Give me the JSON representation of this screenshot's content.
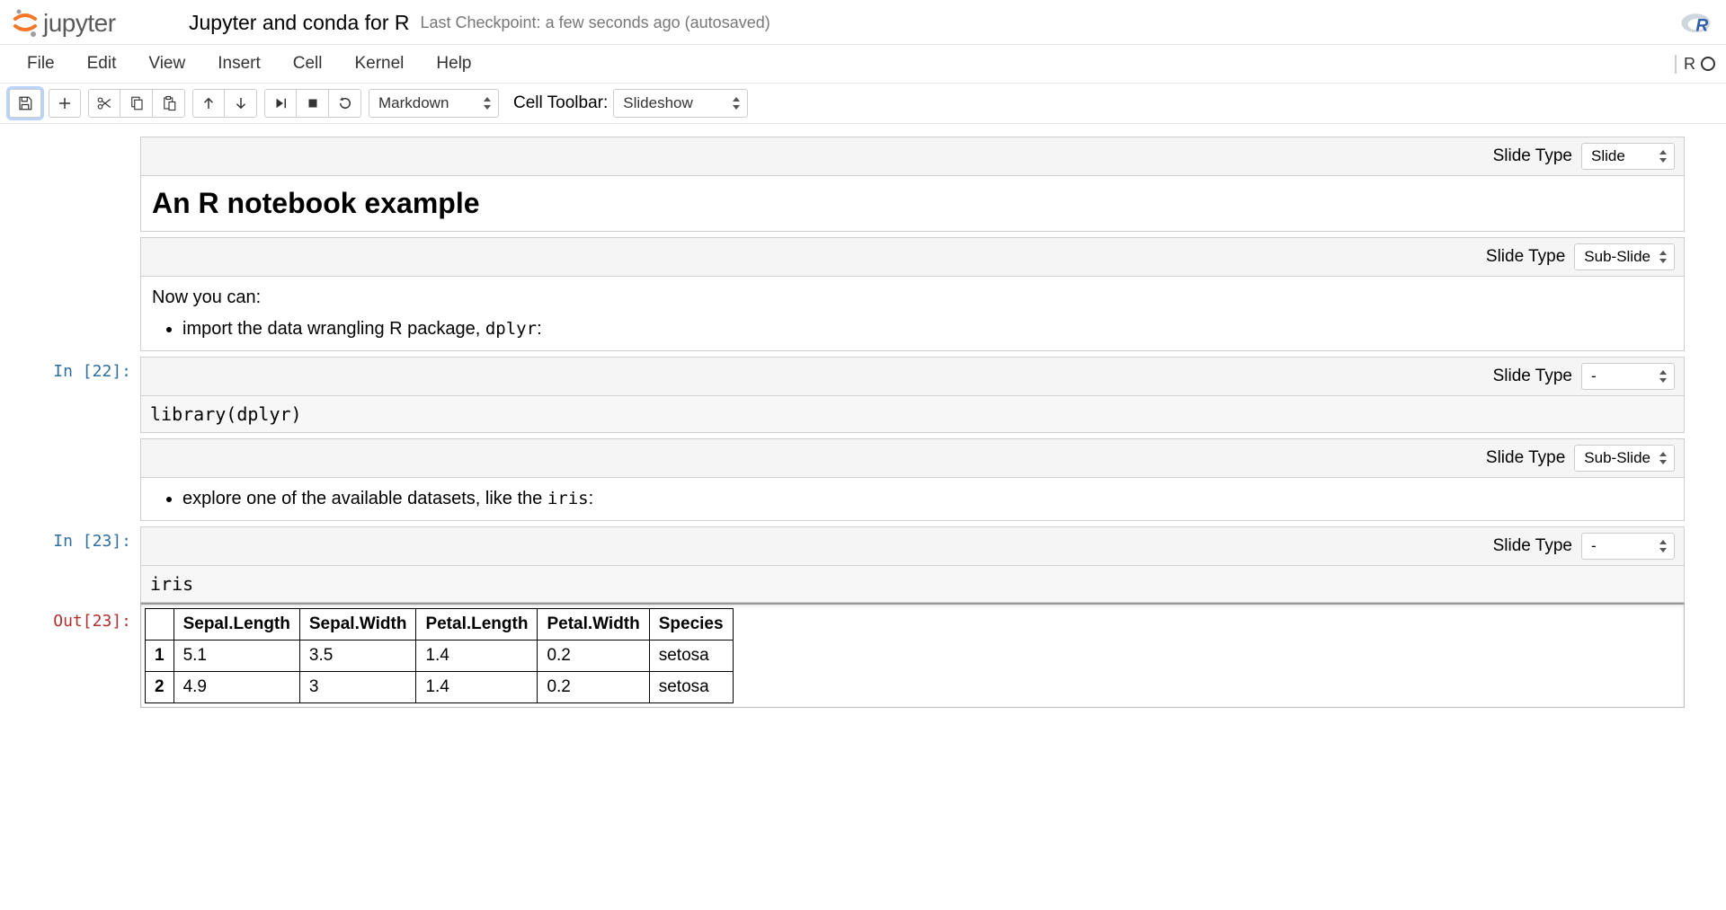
{
  "header": {
    "notebook_name": "Jupyter and conda for R",
    "checkpoint": "Last Checkpoint: a few seconds ago (autosaved)"
  },
  "menubar": {
    "items": [
      "File",
      "Edit",
      "View",
      "Insert",
      "Cell",
      "Kernel",
      "Help"
    ],
    "kernel_name": "R"
  },
  "toolbar": {
    "cell_type": "Markdown",
    "cell_toolbar_label": "Cell Toolbar:",
    "cell_toolbar_value": "Slideshow"
  },
  "cells": [
    {
      "slide_label": "Slide Type",
      "slide_value": "Slide",
      "heading": "An R notebook example"
    },
    {
      "slide_label": "Slide Type",
      "slide_value": "Sub-Slide",
      "text_intro": "Now you can:",
      "bullet_pre": "import the data wrangling R package, ",
      "bullet_code": "dplyr",
      "bullet_post": ":"
    },
    {
      "prompt": "In [22]:",
      "slide_label": "Slide Type",
      "slide_value": "-",
      "code": "library(dplyr)"
    },
    {
      "slide_label": "Slide Type",
      "slide_value": "Sub-Slide",
      "bullet_pre": "explore one of the available datasets, like the ",
      "bullet_code": "iris",
      "bullet_post": ":"
    },
    {
      "prompt": "In [23]:",
      "slide_label": "Slide Type",
      "slide_value": "-",
      "code": "iris",
      "out_prompt": "Out[23]:",
      "table": {
        "headers": [
          "",
          "Sepal.Length",
          "Sepal.Width",
          "Petal.Length",
          "Petal.Width",
          "Species"
        ],
        "rows": [
          [
            "1",
            "5.1",
            "3.5",
            "1.4",
            "0.2",
            "setosa"
          ],
          [
            "2",
            "4.9",
            "3",
            "1.4",
            "0.2",
            "setosa"
          ]
        ]
      }
    }
  ]
}
